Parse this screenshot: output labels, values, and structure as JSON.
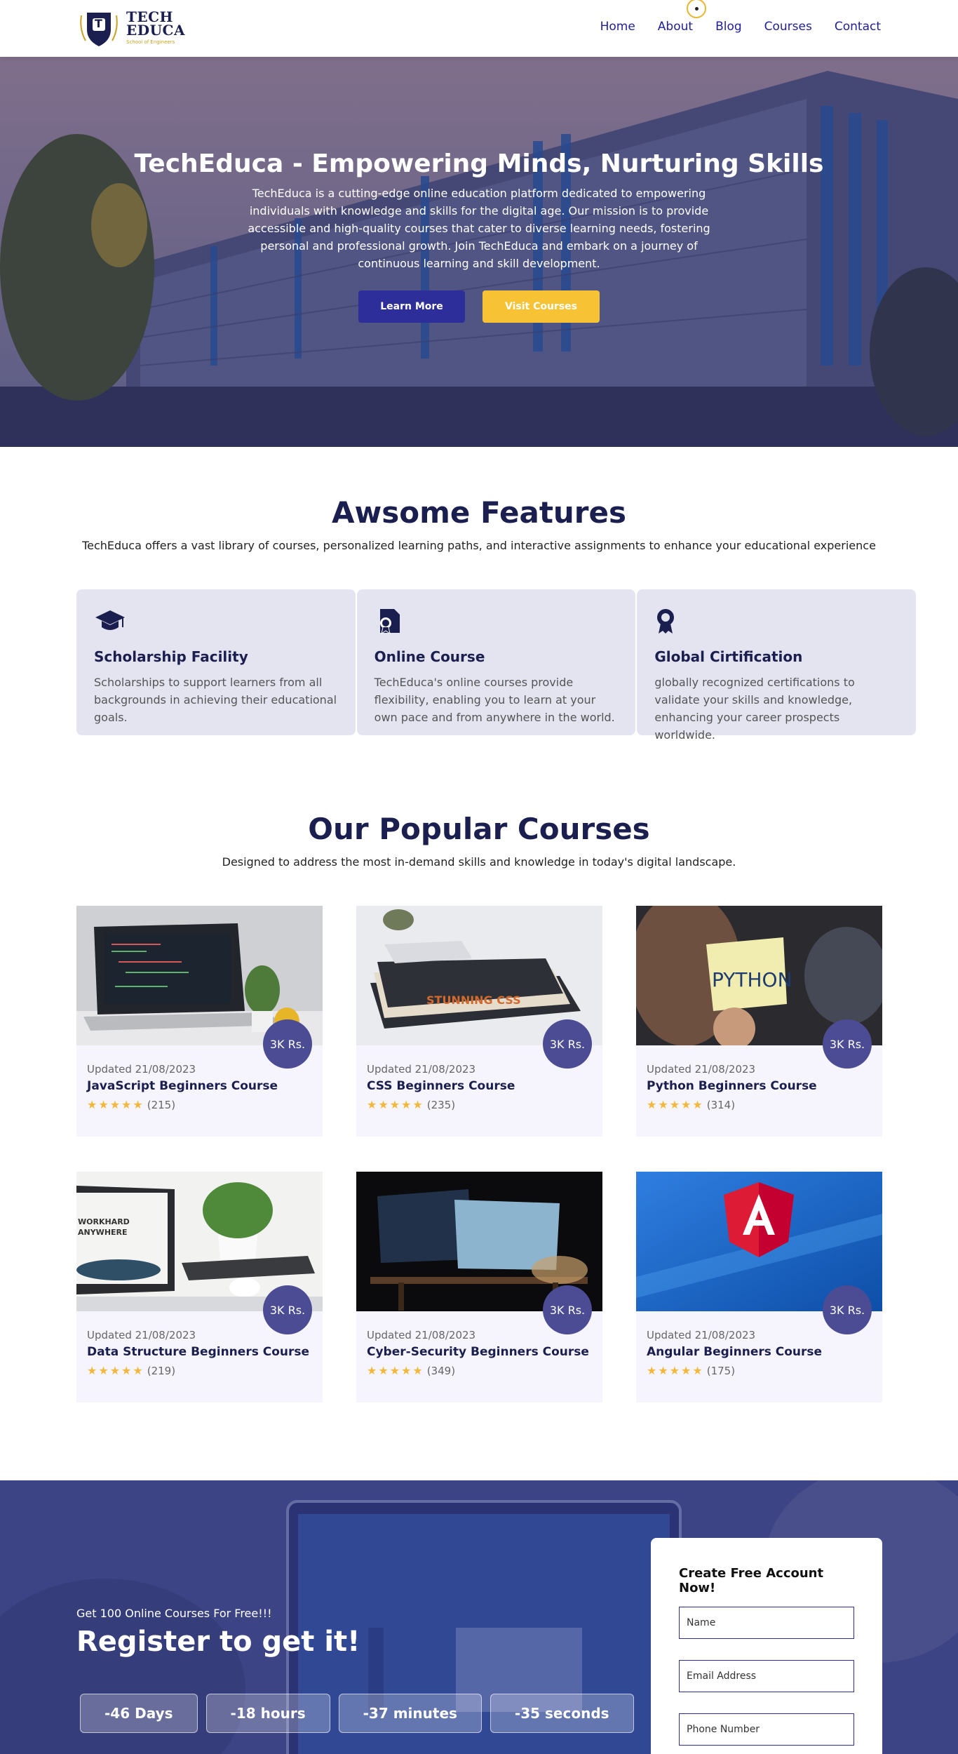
{
  "header": {
    "logo_title_line1": "TECH",
    "logo_title_line2": "EDUCA",
    "logo_subtitle": "School of Engineers",
    "logo_letter": "T",
    "nav": [
      "Home",
      "About",
      "Blog",
      "Courses",
      "Contact"
    ]
  },
  "hero": {
    "title": "TechEduca - Empowering Minds, Nurturing Skills",
    "text": "TechEduca is a cutting-edge online education platform dedicated to empowering individuals with knowledge and skills for the digital age. Our mission is to provide accessible and high-quality courses that cater to diverse learning needs, fostering personal and professional growth. Join TechEduca and embark on a journey of continuous learning and skill development.",
    "learn_more": "Learn More",
    "visit_courses": "Visit Courses"
  },
  "features_section": {
    "title": "Awsome Features",
    "subtitle": "TechEduca offers a vast library of courses, personalized learning paths, and interactive assignments to enhance your educational experience",
    "items": [
      {
        "icon": "graduation-cap-icon",
        "title": "Scholarship Facility",
        "text": "Scholarships to support learners from all backgrounds in achieving their educational goals."
      },
      {
        "icon": "file-certificate-icon",
        "title": "Online Course",
        "text": "TechEduca's online courses provide flexibility, enabling you to learn at your own pace and from anywhere in the world."
      },
      {
        "icon": "award-icon",
        "title": "Global Cirtification",
        "text": "globally recognized certifications to validate your skills and knowledge, enhancing your career prospects worldwide."
      }
    ]
  },
  "courses_section": {
    "title": "Our Popular Courses",
    "subtitle": "Designed to address the most in-demand skills and knowledge in today's digital landscape.",
    "items": [
      {
        "name": "JavaScript Beginners Course",
        "updated": "Updated 21/08/2023",
        "price": "3K Rs.",
        "rating": 5,
        "reviews": "(215)"
      },
      {
        "name": "CSS Beginners Course",
        "updated": "Updated 21/08/2023",
        "price": "3K Rs.",
        "rating": 5,
        "reviews": "(235)"
      },
      {
        "name": "Python Beginners Course",
        "updated": "Updated 21/08/2023",
        "price": "3K Rs.",
        "rating": 5,
        "reviews": "(314)"
      },
      {
        "name": "Data Structure Beginners Course",
        "updated": "Updated 21/08/2023",
        "price": "3K Rs.",
        "rating": 5,
        "reviews": "(219)"
      },
      {
        "name": "Cyber-Security Beginners Course",
        "updated": "Updated 21/08/2023",
        "price": "3K Rs.",
        "rating": 5,
        "reviews": "(349)"
      },
      {
        "name": "Angular Beginners Course",
        "updated": "Updated 21/08/2023",
        "price": "3K Rs.",
        "rating": 5,
        "reviews": "(175)"
      }
    ]
  },
  "register": {
    "small": "Get 100 Online Courses For Free!!!",
    "title": "Register to get it!",
    "countdown": [
      "-46 Days",
      "-18 hours",
      "-37 minutes",
      "-35 seconds"
    ],
    "form_title": "Create Free Account Now!",
    "placeholders": [
      "Name",
      "Email Address",
      "Phone Number"
    ]
  },
  "colors": {
    "brand_navy": "#1b1f4f",
    "brand_blue": "#2e2e9b",
    "accent_yellow": "#f7c234",
    "price_badge": "#4b4c94",
    "star": "#f3b83b"
  }
}
